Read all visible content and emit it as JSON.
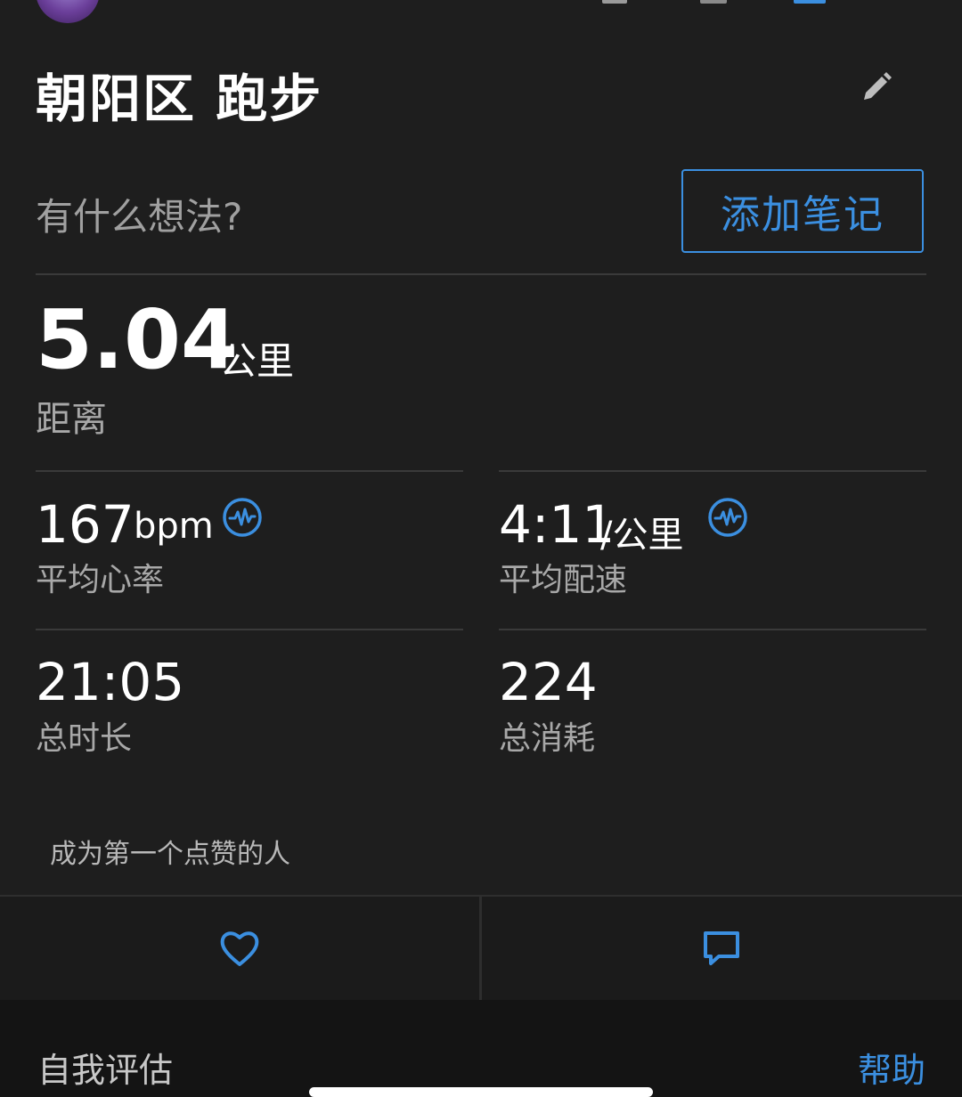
{
  "activity": {
    "title": "朝阳区 跑步"
  },
  "notes": {
    "prompt": "有什么想法?",
    "add_button_label": "添加笔记"
  },
  "distance": {
    "value": "5.04",
    "unit": "公里",
    "label": "距离"
  },
  "stats": {
    "heart_rate": {
      "value": "167",
      "unit": "bpm",
      "label": "平均心率"
    },
    "pace": {
      "value": "4:11",
      "unit": "/公里",
      "label": "平均配速"
    },
    "duration": {
      "value": "21:05",
      "label": "总时长"
    },
    "calories": {
      "value": "224",
      "label": "总消耗"
    }
  },
  "social": {
    "likes_text": "成为第一个点赞的人"
  },
  "footer": {
    "self_eval_label": "自我评估",
    "help_label": "帮助"
  },
  "icons": {
    "edit": "pencil-icon",
    "heart_rate_badge": "pulse-badge-icon",
    "like": "heart-icon",
    "comment": "comment-icon"
  },
  "colors": {
    "background": "#1e1e1e",
    "accent": "#3b8fe0",
    "label": "#a8a8a8"
  }
}
